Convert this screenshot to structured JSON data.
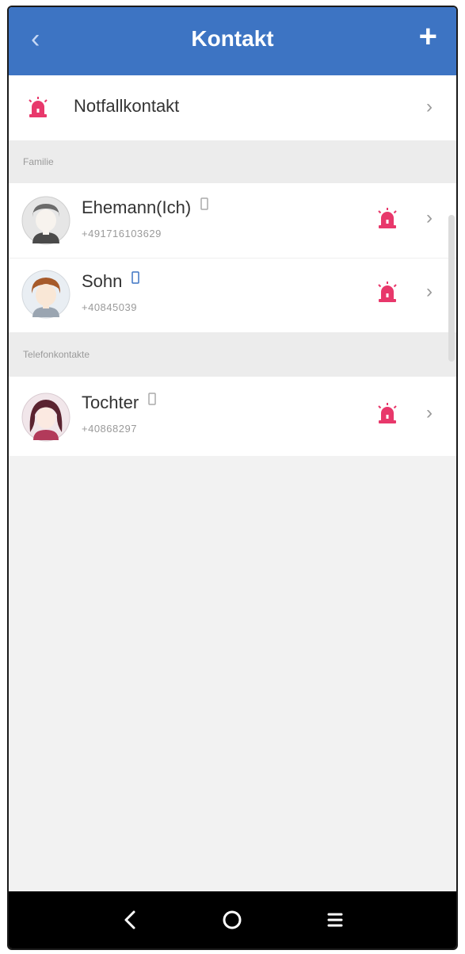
{
  "app_bar": {
    "title": "Kontakt",
    "back_icon": "chevron-left-icon",
    "add_icon": "plus-icon",
    "color": "#3d74c3"
  },
  "emergency": {
    "label": "Notfallkontakt",
    "icon": "siren-icon",
    "accent": "#e8386b"
  },
  "sections": [
    {
      "header": "Familie",
      "contacts": [
        {
          "name": "Ehemann(Ich)",
          "number": "+491716103629",
          "avatar": "avatar-grey-icon"
        },
        {
          "name": "Sohn",
          "number": "+40845039",
          "avatar": "avatar-boy-icon"
        }
      ]
    },
    {
      "header": "Telefonkontakte",
      "contacts": [
        {
          "name": "Tochter",
          "number": "+40868297",
          "avatar": "avatar-girl-icon"
        }
      ]
    }
  ],
  "system_nav": {
    "back_icon": "nav-back-icon",
    "home_icon": "nav-home-icon",
    "recents_icon": "nav-recents-icon"
  }
}
